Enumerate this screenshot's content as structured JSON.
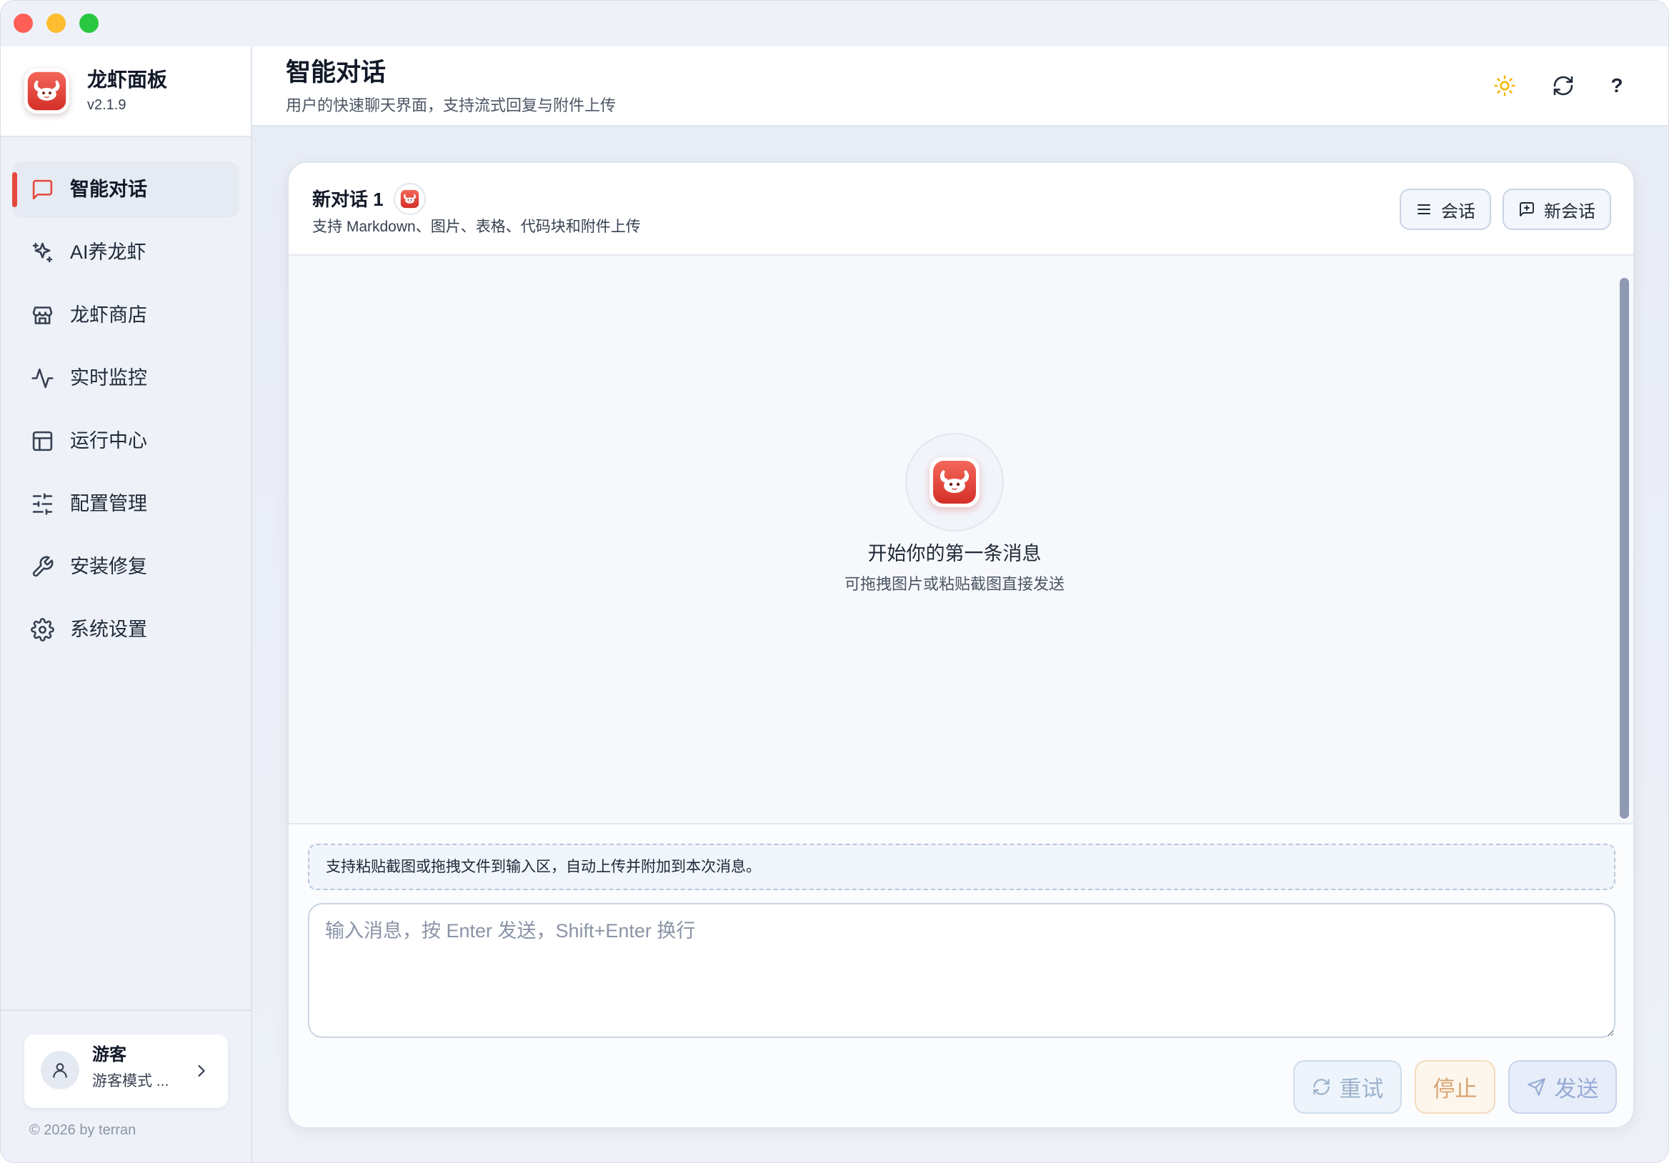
{
  "window": {
    "controls": [
      {
        "name": "close",
        "color": "#ff5f57"
      },
      {
        "name": "minimize",
        "color": "#febc2e"
      },
      {
        "name": "zoom",
        "color": "#28c840"
      }
    ]
  },
  "brand": {
    "name": "龙虾面板",
    "version": "v2.1.9",
    "logo_icon": "lobster-logo-icon"
  },
  "sidebar": {
    "items": [
      {
        "label": "智能对话",
        "icon": "message-square-icon",
        "active": true
      },
      {
        "label": "AI养龙虾",
        "icon": "sparkles-icon",
        "active": false
      },
      {
        "label": "龙虾商店",
        "icon": "store-icon",
        "active": false
      },
      {
        "label": "实时监控",
        "icon": "activity-icon",
        "active": false
      },
      {
        "label": "运行中心",
        "icon": "layout-panel-icon",
        "active": false
      },
      {
        "label": "配置管理",
        "icon": "sliders-icon",
        "active": false
      },
      {
        "label": "安装修复",
        "icon": "wrench-icon",
        "active": false
      },
      {
        "label": "系统设置",
        "icon": "settings-icon",
        "active": false
      }
    ],
    "user": {
      "name": "游客",
      "mode": "游客模式 ...",
      "avatar_icon": "user-icon"
    },
    "copyright": "© 2026 by terran"
  },
  "header": {
    "title": "智能对话",
    "subtitle": "用户的快速聊天界面，支持流式回复与附件上传",
    "actions": {
      "theme_icon": "sun-icon",
      "refresh_icon": "refresh-icon",
      "help_label": "?"
    }
  },
  "chat": {
    "title": "新对话 1",
    "subtitle": "支持 Markdown、图片、表格、代码块和附件上传",
    "sessions_button": {
      "label": "会话",
      "icon": "list-icon"
    },
    "new_session_button": {
      "label": "新会话",
      "icon": "message-plus-icon"
    },
    "empty_state": {
      "title": "开始你的第一条消息",
      "hint": "可拖拽图片或粘贴截图直接发送"
    },
    "attachment_hint": "支持粘贴截图或拖拽文件到输入区，自动上传并附加到本次消息。",
    "input": {
      "value": "",
      "placeholder": "输入消息，按 Enter 发送，Shift+Enter 换行"
    },
    "actions": {
      "retry": {
        "label": "重试",
        "icon": "refresh-cw-icon",
        "disabled": true
      },
      "stop": {
        "label": "停止",
        "disabled": true
      },
      "send": {
        "label": "发送",
        "icon": "send-icon",
        "disabled": true
      }
    }
  },
  "colors": {
    "accent": "#e5483d",
    "sun": "#f4b400",
    "sidebar_bg": "#eef1f8",
    "chat_bg": "#f6f8fc",
    "card_bg": "#ffffff"
  }
}
